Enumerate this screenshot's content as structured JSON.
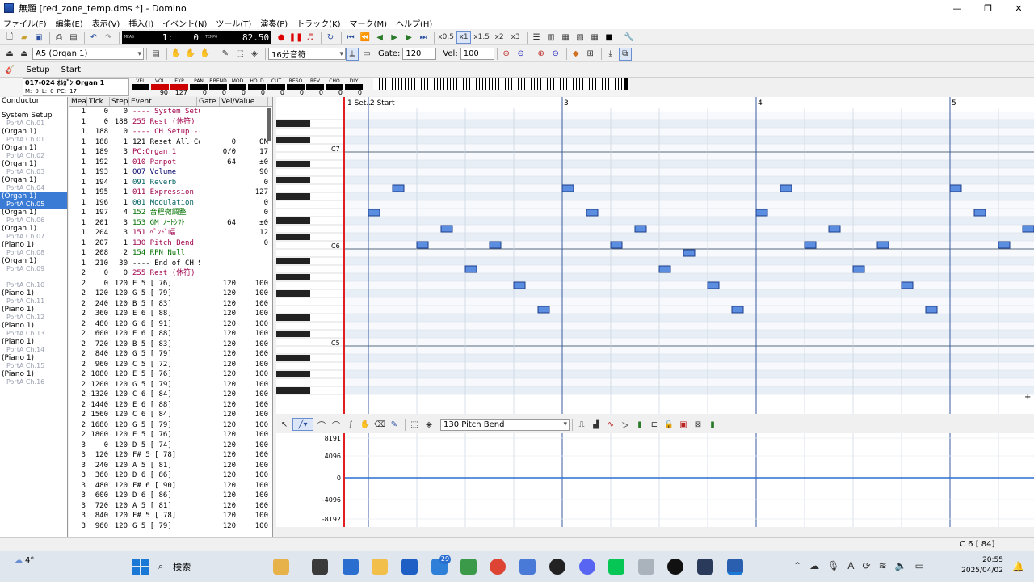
{
  "window": {
    "title": "無題 [red_zone_temp.dms *] - Domino",
    "minimize": "—",
    "maximize": "❐",
    "close": "✕"
  },
  "menu": [
    "ファイル(F)",
    "編集(E)",
    "表示(V)",
    "挿入(I)",
    "イベント(N)",
    "ツール(T)",
    "演奏(P)",
    "トラック(K)",
    "マーク(M)",
    "ヘルプ(H)"
  ],
  "toolbar1": {
    "meas_label": "MEAS",
    "meas_value": "1:",
    "tick_value": "0",
    "tempo_label": "TEMPO",
    "tempo_value": "82.50",
    "speeds": [
      "x0.5",
      "x1",
      "x1.5",
      "x2",
      "x3"
    ]
  },
  "toolbar2": {
    "instrument": "A5 (Organ 1)",
    "note_length": "16分音符",
    "gate_label": "Gate:",
    "gate_value": "120",
    "vel_label": "Vel:",
    "vel_value": "100"
  },
  "tabs": [
    "Setup",
    "Start"
  ],
  "info": {
    "track_name": "017-024 ｵﾙｶﾞﾝ Organ 1",
    "m_label": "M:",
    "m_value": "0",
    "l_label": "L:",
    "l_value": "0",
    "pc_label": "PC:",
    "pc_value": "17",
    "sliders": [
      {
        "label": "VEL",
        "value": "",
        "color": "#000"
      },
      {
        "label": "VOL",
        "value": "90",
        "color": "#cc0000"
      },
      {
        "label": "EXP",
        "value": "127",
        "color": "#cc0000"
      },
      {
        "label": "PAN",
        "value": "0",
        "color": "#000"
      },
      {
        "label": "P.BEND",
        "value": "0",
        "color": "#000"
      },
      {
        "label": "MOD",
        "value": "0",
        "color": "#000"
      },
      {
        "label": "HOLD",
        "value": "0",
        "color": "#000"
      },
      {
        "label": "CUT",
        "value": "0",
        "color": "#000"
      },
      {
        "label": "RESO",
        "value": "0",
        "color": "#000"
      },
      {
        "label": "REV",
        "value": "0",
        "color": "#000"
      },
      {
        "label": "CHO",
        "value": "0",
        "color": "#000"
      },
      {
        "label": "DLY",
        "value": "0",
        "color": "#000"
      }
    ]
  },
  "tracks": [
    {
      "name": "Conductor",
      "sub": ""
    },
    {
      "name": "System Setup",
      "sub": "PortA  Ch.01"
    },
    {
      "name": "(Organ 1)",
      "sub": "PortA  Ch.01"
    },
    {
      "name": "(Organ 1)",
      "sub": "PortA  Ch.02"
    },
    {
      "name": "(Organ 1)",
      "sub": "PortA  Ch.03"
    },
    {
      "name": "(Organ 1)",
      "sub": "PortA  Ch.04"
    },
    {
      "name": "(Organ 1)",
      "sub": "PortA  Ch.05",
      "selected": true
    },
    {
      "name": "(Organ 1)",
      "sub": "PortA  Ch.06"
    },
    {
      "name": "(Organ 1)",
      "sub": "PortA  Ch.07"
    },
    {
      "name": "(Piano 1)",
      "sub": "PortA  Ch.08"
    },
    {
      "name": "(Organ 1)",
      "sub": "PortA  Ch.09"
    },
    {
      "name": "",
      "sub": "PortA  Ch.10"
    },
    {
      "name": "(Piano 1)",
      "sub": "PortA  Ch.11"
    },
    {
      "name": "(Piano 1)",
      "sub": "PortA  Ch.12"
    },
    {
      "name": "(Piano 1)",
      "sub": "PortA  Ch.13"
    },
    {
      "name": "(Piano 1)",
      "sub": "PortA  Ch.14"
    },
    {
      "name": "(Piano 1)",
      "sub": "PortA  Ch.15"
    },
    {
      "name": "(Piano 1)",
      "sub": "PortA  Ch.16"
    }
  ],
  "event_headers": [
    "Mea",
    "Tick",
    "Step",
    "Event",
    "Gate",
    "Vel/Value"
  ],
  "events": [
    [
      "1",
      "0",
      "0",
      "---- System Setup ---------",
      "",
      "",
      "#a0004a"
    ],
    [
      "1",
      "0",
      "188",
      "255 Rest (休符)",
      "",
      "",
      "#a0004a"
    ],
    [
      "1",
      "188",
      "0",
      "---- CH Setup ----------------",
      "",
      "",
      "#a0004a"
    ],
    [
      "1",
      "188",
      "1",
      "121 Reset All Control",
      "0",
      "ON",
      "#000"
    ],
    [
      "1",
      "189",
      "3",
      "PC:Organ 1",
      "0/0",
      "17",
      "#a0004a"
    ],
    [
      "1",
      "192",
      "1",
      "010 Panpot",
      "64",
      "±0",
      "#a0004a"
    ],
    [
      "1",
      "193",
      "1",
      "007 Volume",
      "",
      "90",
      "#00006a"
    ],
    [
      "1",
      "194",
      "1",
      "091 Reverb",
      "",
      "0",
      "#006060"
    ],
    [
      "1",
      "195",
      "1",
      "011 Expression",
      "",
      "127",
      "#a0004a"
    ],
    [
      "1",
      "196",
      "1",
      "001 Modulation",
      "",
      "0",
      "#006060"
    ],
    [
      "1",
      "197",
      "4",
      "152 音程微調整",
      "",
      "0",
      "#007000"
    ],
    [
      "1",
      "201",
      "3",
      "153 GM ﾉｰﾄｼﾌﾄ",
      "64",
      "±0",
      "#007000"
    ],
    [
      "1",
      "204",
      "3",
      "151 ﾍﾞﾝﾄﾞ幅",
      "",
      "12",
      "#a0004a"
    ],
    [
      "1",
      "207",
      "1",
      "130 Pitch Bend",
      "",
      "0",
      "#a0004a"
    ],
    [
      "1",
      "208",
      "2",
      "154 RPN Null",
      "",
      "",
      "#007000"
    ],
    [
      "1",
      "210",
      "30",
      "---- End of CH Setup ----------",
      "",
      "",
      "#000"
    ],
    [
      "2",
      "0",
      "0",
      "255 Rest (休符)",
      "",
      "",
      "#a0004a"
    ],
    [
      "2",
      "0",
      "120",
      "E  5 [ 76]",
      "120",
      "100",
      "#000"
    ],
    [
      "2",
      "120",
      "120",
      "G  5 [ 79]",
      "120",
      "100",
      "#000"
    ],
    [
      "2",
      "240",
      "120",
      "B  5 [ 83]",
      "120",
      "100",
      "#000"
    ],
    [
      "2",
      "360",
      "120",
      "E  6 [ 88]",
      "120",
      "100",
      "#000"
    ],
    [
      "2",
      "480",
      "120",
      "G  6 [ 91]",
      "120",
      "100",
      "#000"
    ],
    [
      "2",
      "600",
      "120",
      "E  6 [ 88]",
      "120",
      "100",
      "#000"
    ],
    [
      "2",
      "720",
      "120",
      "B  5 [ 83]",
      "120",
      "100",
      "#000"
    ],
    [
      "2",
      "840",
      "120",
      "G  5 [ 79]",
      "120",
      "100",
      "#000"
    ],
    [
      "2",
      "960",
      "120",
      "C  5 [ 72]",
      "120",
      "100",
      "#000"
    ],
    [
      "2",
      "1080",
      "120",
      "E  5 [ 76]",
      "120",
      "100",
      "#000"
    ],
    [
      "2",
      "1200",
      "120",
      "G  5 [ 79]",
      "120",
      "100",
      "#000"
    ],
    [
      "2",
      "1320",
      "120",
      "C  6 [ 84]",
      "120",
      "100",
      "#000"
    ],
    [
      "2",
      "1440",
      "120",
      "E  6 [ 88]",
      "120",
      "100",
      "#000"
    ],
    [
      "2",
      "1560",
      "120",
      "C  6 [ 84]",
      "120",
      "100",
      "#000"
    ],
    [
      "2",
      "1680",
      "120",
      "G  5 [ 79]",
      "120",
      "100",
      "#000"
    ],
    [
      "2",
      "1800",
      "120",
      "E  5 [ 76]",
      "120",
      "100",
      "#000"
    ],
    [
      "3",
      "0",
      "120",
      "D  5 [ 74]",
      "120",
      "100",
      "#000"
    ],
    [
      "3",
      "120",
      "120",
      "F# 5 [ 78]",
      "120",
      "100",
      "#000"
    ],
    [
      "3",
      "240",
      "120",
      "A  5 [ 81]",
      "120",
      "100",
      "#000"
    ],
    [
      "3",
      "360",
      "120",
      "D  6 [ 86]",
      "120",
      "100",
      "#000"
    ],
    [
      "3",
      "480",
      "120",
      "F# 6 [ 90]",
      "120",
      "100",
      "#000"
    ],
    [
      "3",
      "600",
      "120",
      "D  6 [ 86]",
      "120",
      "100",
      "#000"
    ],
    [
      "3",
      "720",
      "120",
      "A  5 [ 81]",
      "120",
      "100",
      "#000"
    ],
    [
      "3",
      "840",
      "120",
      "F# 5 [ 78]",
      "120",
      "100",
      "#000"
    ],
    [
      "3",
      "960",
      "120",
      "G  5 [ 79]",
      "120",
      "100",
      "#000"
    ]
  ],
  "ruler": {
    "marks": [
      "1 Set..",
      "2 Start",
      "3",
      "4",
      "5"
    ]
  },
  "pitch_labels": [
    "C7",
    "C6",
    "C5"
  ],
  "notes": [
    88,
    91,
    84,
    86,
    81,
    84,
    79,
    76,
    91,
    88,
    84,
    86,
    81,
    83,
    79,
    76,
    88,
    91,
    84,
    86,
    81,
    84,
    79,
    76,
    91,
    88,
    84,
    86,
    81,
    83,
    79,
    76
  ],
  "ctrl": {
    "event_select": "130 Pitch Bend",
    "y_labels": [
      "8191",
      "4096",
      "0",
      "-4096",
      "-8192"
    ]
  },
  "status": {
    "position": "C 6 [ 84]"
  },
  "taskbar": {
    "weather": "4°",
    "search": "検索",
    "badge": "29",
    "time": "20:55",
    "date": "2025/04/02"
  }
}
